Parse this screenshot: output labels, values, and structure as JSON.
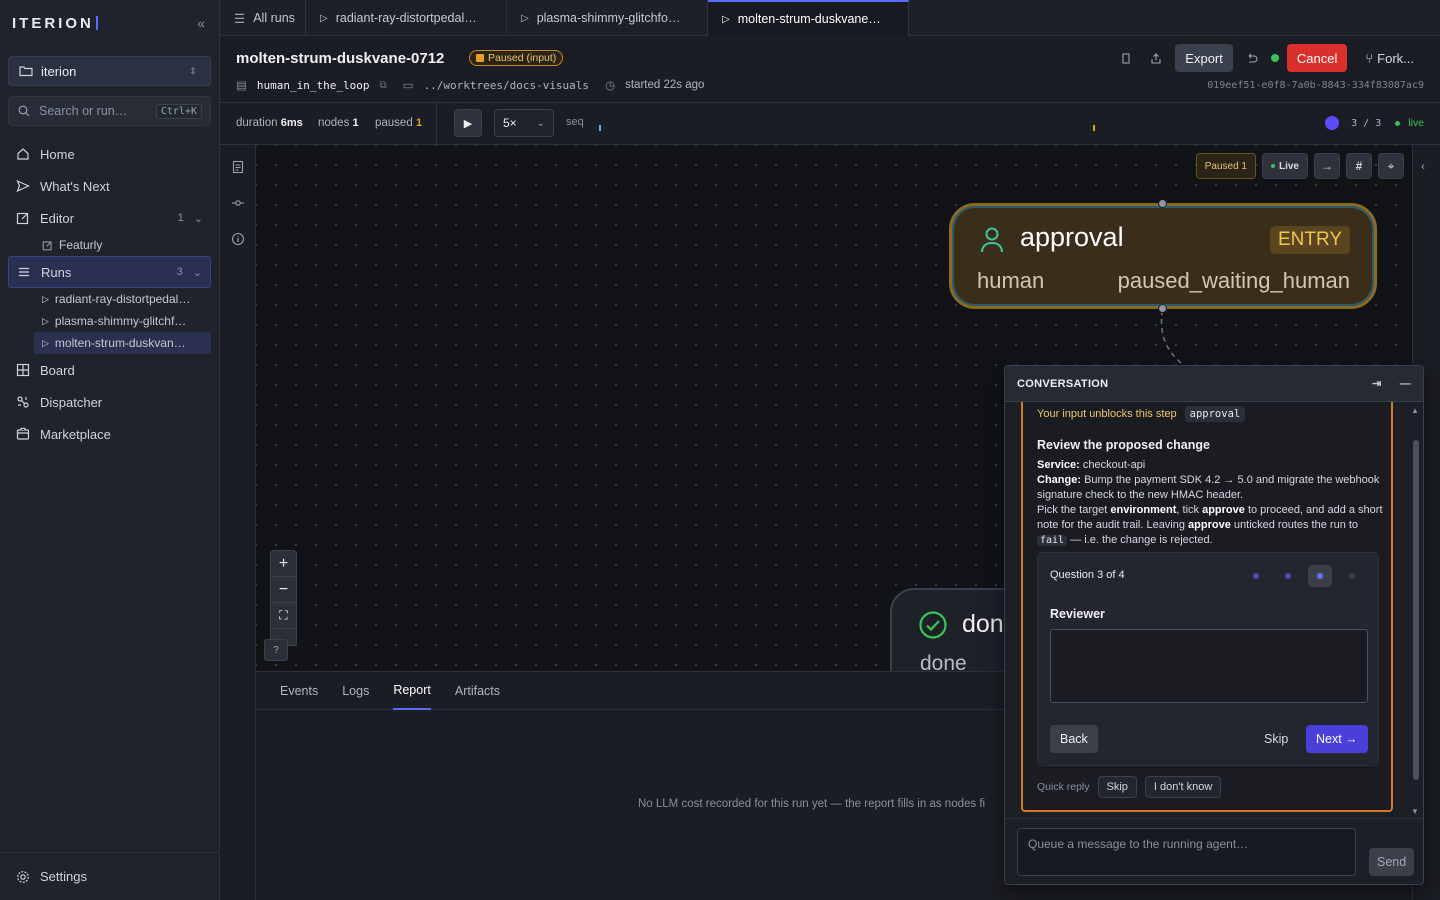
{
  "app": {
    "logo": "ITERION"
  },
  "sidebar": {
    "workspace": "iterion",
    "search_placeholder": "Search or run…",
    "search_shortcut": "Ctrl+K",
    "nav": [
      {
        "label": "Home",
        "icon": "home-icon"
      },
      {
        "label": "What's Next",
        "icon": "send-icon"
      },
      {
        "label": "Editor",
        "icon": "edit-icon",
        "count": "1"
      },
      {
        "label": "Runs",
        "icon": "list-icon",
        "count": "3"
      },
      {
        "label": "Board",
        "icon": "grid-icon"
      },
      {
        "label": "Dispatcher",
        "icon": "dispatcher-icon"
      },
      {
        "label": "Marketplace",
        "icon": "store-icon"
      }
    ],
    "editor_children": [
      "Featurly"
    ],
    "run_children": [
      "radiant-ray-distortpedal…",
      "plasma-shimmy-glitchf…",
      "molten-strum-duskvan…"
    ],
    "settings_label": "Settings"
  },
  "tabs": {
    "all_runs": "All runs",
    "items": [
      "radiant-ray-distortpedal…",
      "plasma-shimmy-glitchfo…",
      "molten-strum-duskvane…"
    ]
  },
  "header": {
    "title": "molten-strum-duskvane-0712",
    "status_badge": "Paused (input)",
    "workflow": "human_in_the_loop",
    "worktree": "../worktrees/docs-visuals",
    "started": "started 22s ago",
    "run_id": "019eef51-e0f8-7a0b-8843-334f83087ac9",
    "export_label": "Export",
    "cancel_label": "Cancel",
    "fork_label": "Fork..."
  },
  "toolbar": {
    "duration_label": "duration",
    "duration_value": "6ms",
    "nodes_label": "nodes",
    "nodes_value": "1",
    "paused_label": "paused",
    "paused_value": "1",
    "speed": "5×",
    "seq_label": "seq",
    "progress": "3 / 3",
    "live_label": "live"
  },
  "canvas": {
    "paused_chip": "Paused 1",
    "live_chip": "Live",
    "help_label": "?",
    "approval_node": {
      "title": "approval",
      "badge": "ENTRY",
      "kind": "human",
      "status": "paused_waiting_human"
    },
    "done_node": {
      "title": "done",
      "kind": "done"
    }
  },
  "bottom_panel": {
    "tabs": [
      "Events",
      "Logs",
      "Report",
      "Artifacts"
    ],
    "active_tab": "Report",
    "empty_message": "No LLM cost recorded for this run yet — the report fills in as nodes fi"
  },
  "conversation": {
    "header": "CONVERSATION",
    "unblock_label": "Your input unblocks this step",
    "unblock_step": "approval",
    "review_title": "Review the proposed change",
    "service_label": "Service:",
    "service_value": "checkout-api",
    "change_label": "Change:",
    "change_value": "Bump the payment SDK 4.2 → 5.0 and migrate the webhook signature check to the new HMAC header.",
    "pick_text_1": "Pick the target",
    "environment_word": "environment",
    "pick_text_2": ", tick",
    "approve_word": "approve",
    "pick_text_3": "to proceed, and add a short note for the audit trail. Leaving",
    "approve_word_2": "approve",
    "pick_text_4": "unticked routes the run to",
    "fail_word": "fail",
    "pick_text_5": "— i.e. the change is rejected.",
    "question_counter": "Question 3 of 4",
    "question_label": "Reviewer",
    "back_label": "Back",
    "skip_label": "Skip",
    "next_label": "Next →",
    "quick_reply_label": "Quick reply",
    "quick_replies": [
      "Skip",
      "I don't know"
    ],
    "message_placeholder": "Queue a message to the running agent…",
    "send_label": "Send"
  },
  "colors": {
    "accent": "#5b6bff",
    "cancel": "#d9302b",
    "paused": "#e8a11e",
    "live": "#3bc35a",
    "next_button": "#4a3fd8"
  }
}
